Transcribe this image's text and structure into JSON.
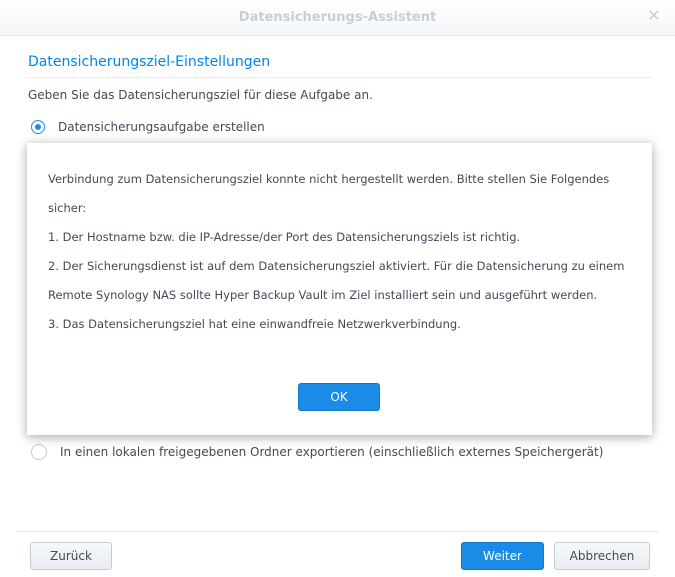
{
  "window": {
    "title": "Datensicherungs-Assistent",
    "close_icon": "close-icon"
  },
  "section": {
    "title": "Datensicherungsziel-Einstellungen",
    "instruction": "Geben Sie das Datensicherungsziel für diese Aufgabe an."
  },
  "options": {
    "create_task": {
      "label": "Datensicherungsaufgabe erstellen",
      "checked": true
    },
    "export_local": {
      "label": "In einen lokalen freigegebenen Ordner exportieren (einschließlich externes Speichergerät)",
      "checked": false
    }
  },
  "dialog": {
    "line1": "Verbindung zum Datensicherungsziel konnte nicht hergestellt werden. Bitte stellen Sie Folgendes sicher:",
    "line2": "1. Der Hostname bzw. die IP-Adresse/der Port des Datensicherungsziels ist richtig.",
    "line3": "2. Der Sicherungsdienst ist auf dem Datensicherungsziel aktiviert. Für die Datensicherung zu einem Remote Synology NAS sollte Hyper Backup Vault im Ziel installiert sein und ausgeführt werden.",
    "line4": "3. Das Datensicherungsziel hat eine einwandfreie Netzwerkverbindung.",
    "ok_label": "OK"
  },
  "footer": {
    "back_label": "Zurück",
    "next_label": "Weiter",
    "cancel_label": "Abbrechen"
  },
  "colors": {
    "accent": "#1a8ce8",
    "title_text": "#0086e5",
    "body_text": "#414b55"
  }
}
